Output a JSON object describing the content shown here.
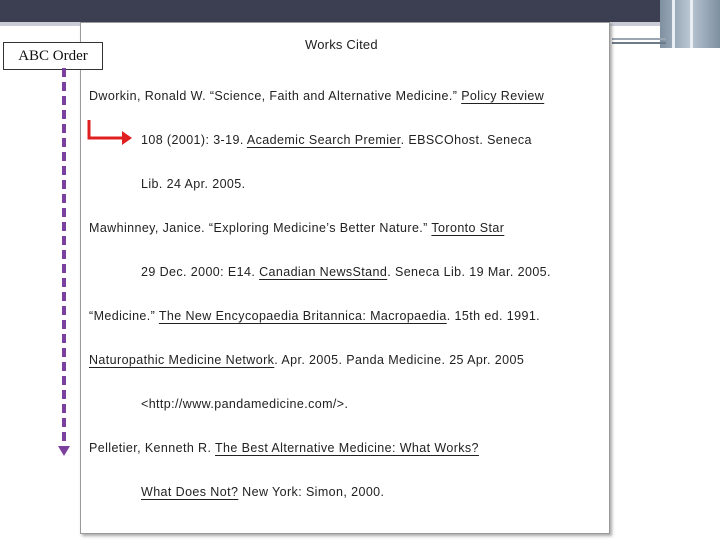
{
  "abc_label": "ABC Order",
  "doc": {
    "title": "Works Cited",
    "lines": [
      {
        "plain": "Dworkin, Ronald W.  “Science, Faith and Alternative Medicine.” ",
        "underline": "Policy Review",
        "tail": ""
      },
      {
        "plain": "108 (2001): 3-19. ",
        "underline": "Academic Search Premier",
        "tail": ". EBSCOhost. Seneca"
      },
      {
        "plain": "Lib. 24 Apr. 2005.",
        "underline": "",
        "tail": ""
      },
      {
        "plain": "Mawhinney, Janice.  “Exploring Medicine’s Better Nature.” ",
        "underline": "Toronto Star",
        "tail": ""
      },
      {
        "plain": "29 Dec. 2000: E14. ",
        "underline": "Canadian NewsStand",
        "tail": ". Seneca Lib. 19 Mar. 2005."
      },
      {
        "plain": "“Medicine.” ",
        "underline": "The New Encycopaedia Britannica: Macropaedia",
        "tail": ". 15th ed. 1991."
      },
      {
        "plain": "",
        "underline": "Naturopathic Medicine Network",
        "tail": ". Apr. 2005. Panda Medicine. 25 Apr. 2005"
      },
      {
        "plain": "<http://www.pandamedicine.com/>.",
        "underline": "",
        "tail": ""
      },
      {
        "plain": "Pelletier, Kenneth R. ",
        "underline": "The Best Alternative Medicine: What Works?",
        "tail": ""
      },
      {
        "plain": "",
        "underline": "What Does Not?",
        "tail": "  New York: Simon, 2000."
      }
    ]
  }
}
